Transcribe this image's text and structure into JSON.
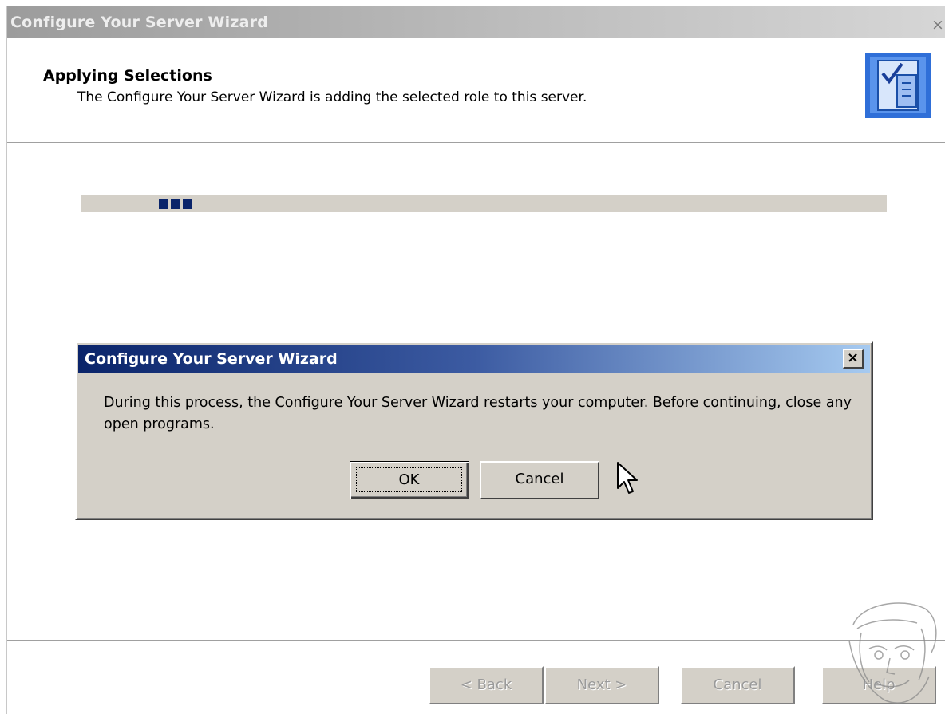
{
  "window": {
    "title": "Configure Your Server Wizard",
    "close_glyph": "×"
  },
  "header": {
    "title": "Applying Selections",
    "subtitle": "The Configure Your Server Wizard is adding the selected role to this server.",
    "icon": "wizard-checklist-icon"
  },
  "progress": {
    "style": "marquee",
    "active_blocks": 3
  },
  "dialog": {
    "title": "Configure Your Server Wizard",
    "close_glyph": "×",
    "message": "During this process, the Configure Your Server Wizard restarts your computer. Before continuing, close any open programs.",
    "ok_label": "OK",
    "cancel_label": "Cancel"
  },
  "footer": {
    "back_label": "< Back",
    "next_label": "Next >",
    "cancel_label": "Cancel",
    "help_label": "Help"
  },
  "colors": {
    "dialog_title_start": "#0a246a",
    "dialog_title_end": "#a6caf0",
    "progress_block": "#0a246a",
    "button_face": "#d4d0c8"
  }
}
